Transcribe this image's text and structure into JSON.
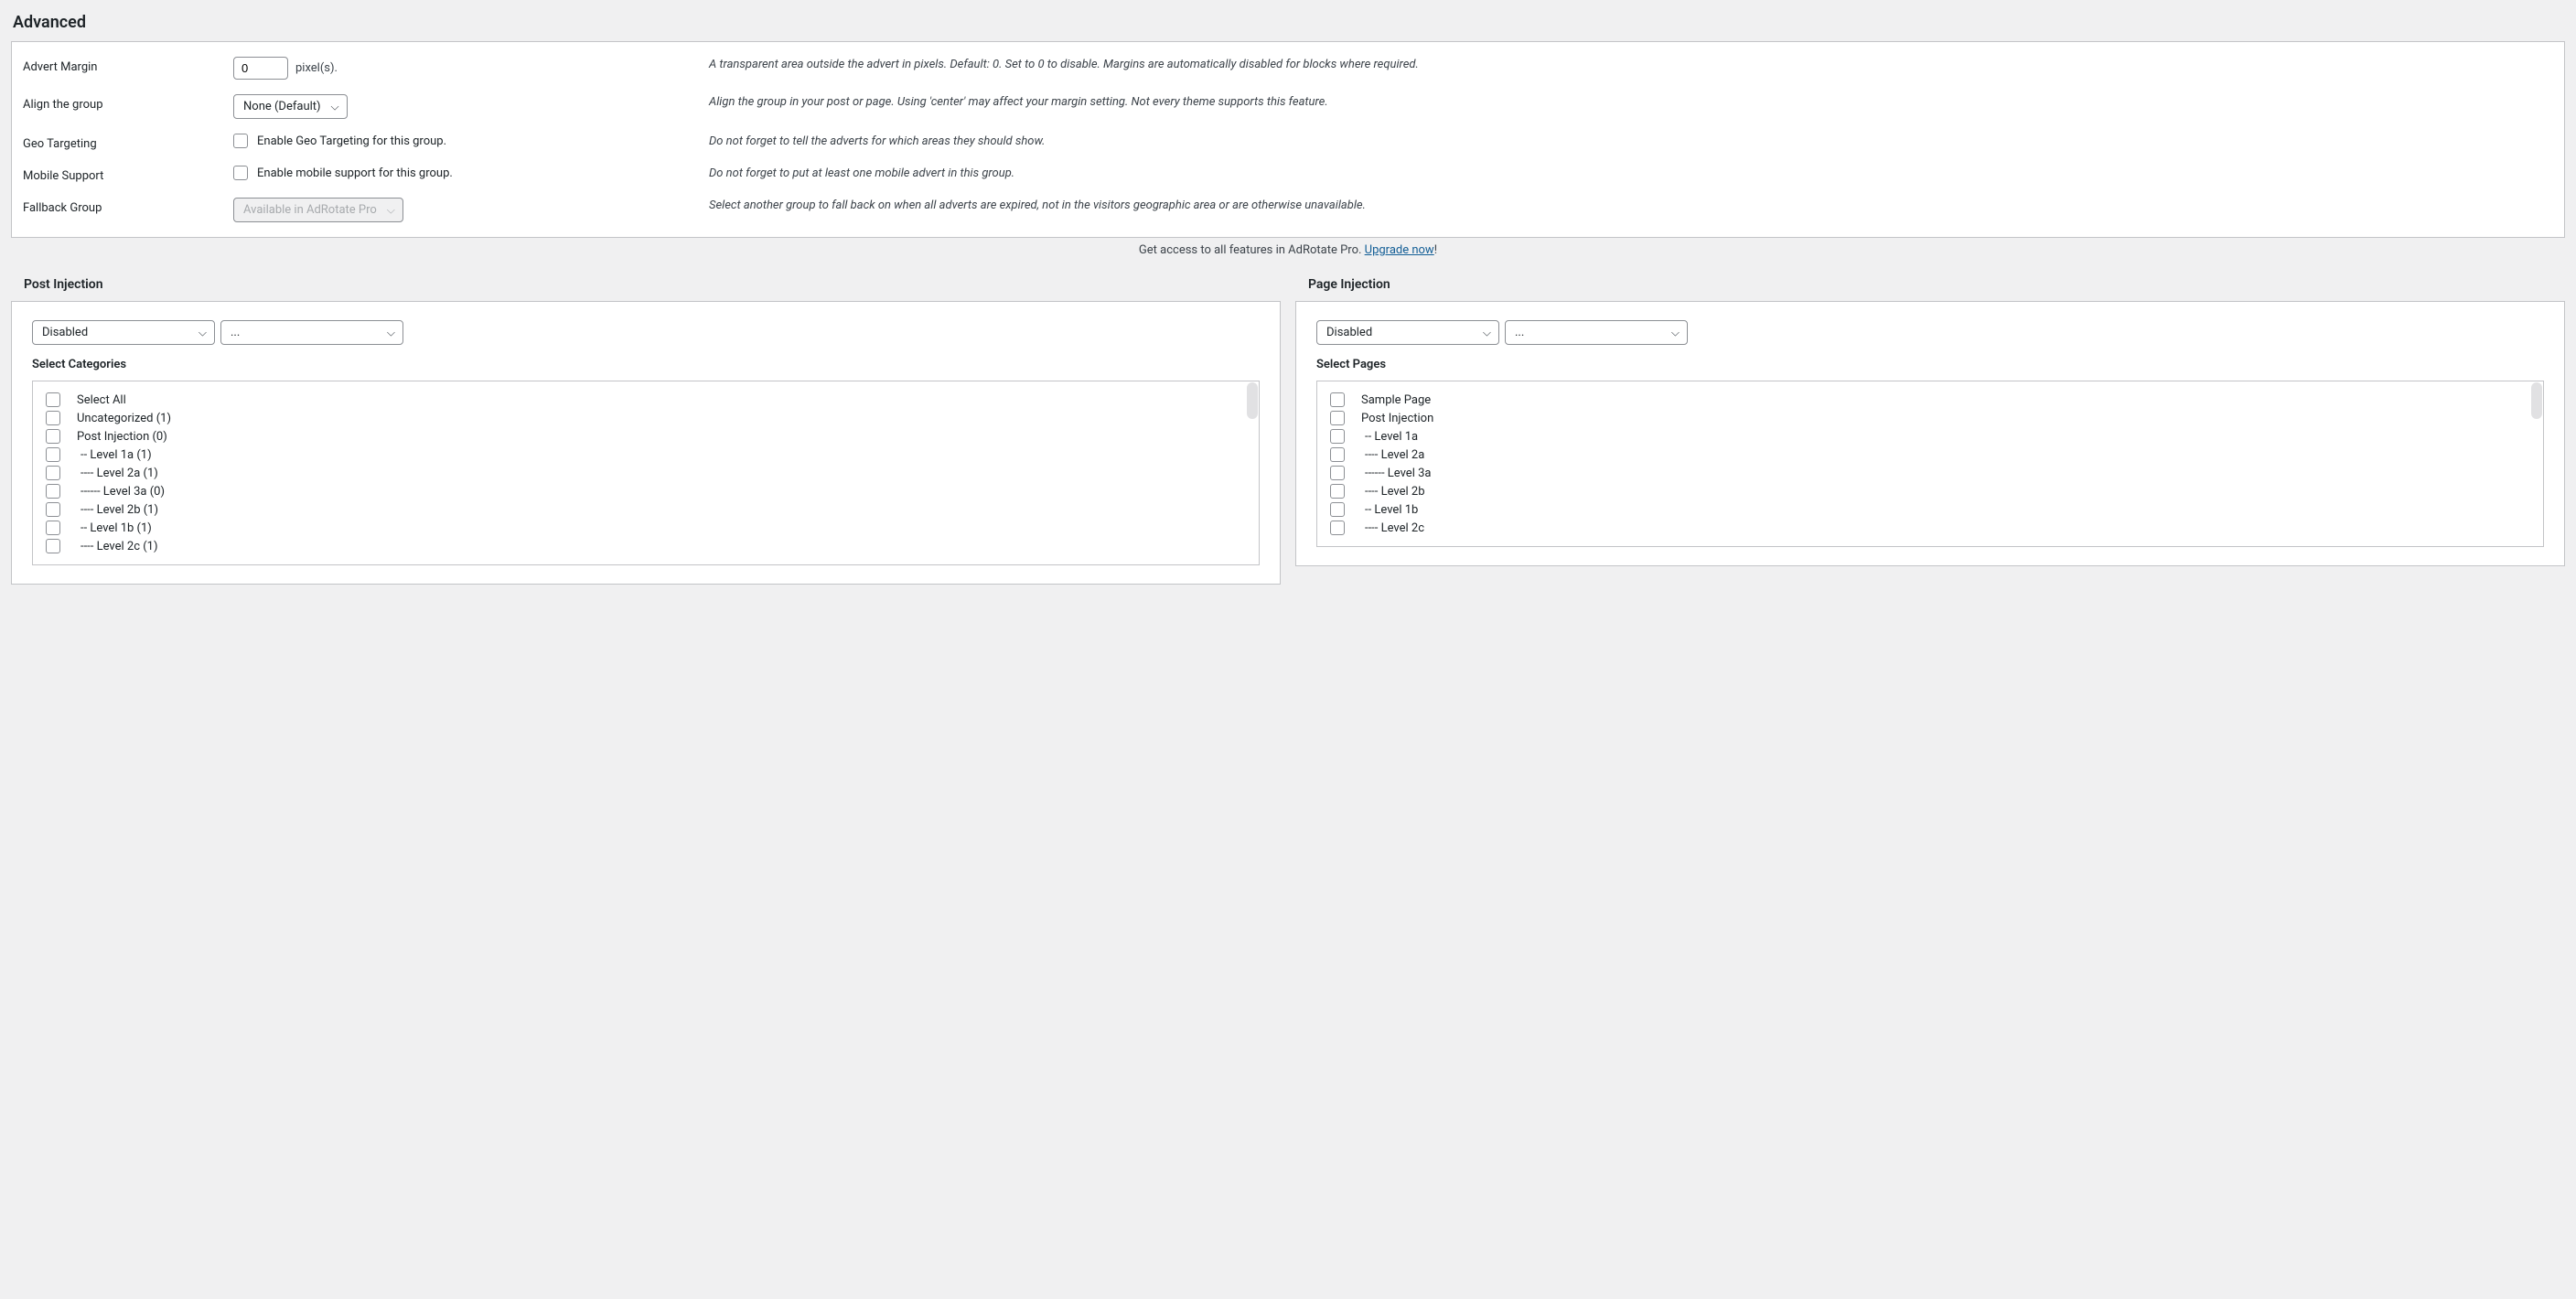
{
  "advanced": {
    "heading": "Advanced",
    "rows": {
      "advert_margin": {
        "label": "Advert Margin",
        "value": "0",
        "suffix": "pixel(s).",
        "help": "A transparent area outside the advert in pixels. Default: 0. Set to 0 to disable. Margins are automatically disabled for blocks where required."
      },
      "align": {
        "label": "Align the group",
        "value": "None (Default)",
        "help": "Align the group in your post or page. Using 'center' may affect your margin setting. Not every theme supports this feature."
      },
      "geo": {
        "label": "Geo Targeting",
        "checkbox_label": "Enable Geo Targeting for this group.",
        "help": "Do not forget to tell the adverts for which areas they should show."
      },
      "mobile": {
        "label": "Mobile Support",
        "checkbox_label": "Enable mobile support for this group.",
        "help": "Do not forget to put at least one mobile advert in this group."
      },
      "fallback": {
        "label": "Fallback Group",
        "value": "Available in AdRotate Pro",
        "help": "Select another group to fall back on when all adverts are expired, not in the visitors geographic area or are otherwise unavailable."
      }
    },
    "upgrade_prefix": "Get access to all features in AdRotate Pro. ",
    "upgrade_link": "Upgrade now",
    "upgrade_suffix": "!"
  },
  "post_injection": {
    "heading": "Post Injection",
    "mode": "Disabled",
    "secondary": "...",
    "list_heading": "Select Categories",
    "items": [
      {
        "label": "Select All",
        "indent": 0
      },
      {
        "label": "Uncategorized (1)",
        "indent": 0
      },
      {
        "label": "Post Injection (0)",
        "indent": 0
      },
      {
        "label": "-- Level 1a (1)",
        "indent": 1
      },
      {
        "label": "---- Level 2a (1)",
        "indent": 2
      },
      {
        "label": "------ Level 3a (0)",
        "indent": 3
      },
      {
        "label": "---- Level 2b (1)",
        "indent": 2
      },
      {
        "label": "-- Level 1b (1)",
        "indent": 1
      },
      {
        "label": "---- Level 2c (1)",
        "indent": 2
      }
    ]
  },
  "page_injection": {
    "heading": "Page Injection",
    "mode": "Disabled",
    "secondary": "...",
    "list_heading": "Select Pages",
    "items": [
      {
        "label": "Sample Page",
        "indent": 0
      },
      {
        "label": "Post Injection",
        "indent": 0
      },
      {
        "label": "-- Level 1a",
        "indent": 1
      },
      {
        "label": "---- Level 2a",
        "indent": 2
      },
      {
        "label": "------ Level 3a",
        "indent": 3
      },
      {
        "label": "---- Level 2b",
        "indent": 2
      },
      {
        "label": "-- Level 1b",
        "indent": 1
      },
      {
        "label": "---- Level 2c",
        "indent": 2
      }
    ]
  }
}
